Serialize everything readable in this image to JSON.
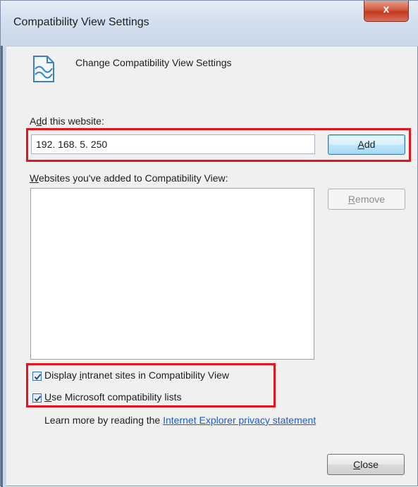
{
  "window": {
    "title": "Compatibility View Settings",
    "close_label": "x"
  },
  "header": {
    "icon": "compatibility-page-icon",
    "text": "Change Compatibility View Settings"
  },
  "add_section": {
    "label_prefix": "A",
    "label_accel": "d",
    "label_suffix": "d this website:",
    "value": "192. 168. 5. 250",
    "add_button_accel": "A",
    "add_button_rest": "dd"
  },
  "list_section": {
    "label_accel": "W",
    "label_suffix": "ebsites you've added to Compatibility View:",
    "items": [],
    "remove_button_accel": "R",
    "remove_button_rest": "emove"
  },
  "options": {
    "intranet": {
      "prefix": "Display ",
      "accel": "i",
      "suffix": "ntranet sites in Compatibility View",
      "checked": true
    },
    "ms_lists": {
      "prefix": "",
      "accel": "U",
      "suffix": "se Microsoft compatibility lists",
      "checked": true
    }
  },
  "footer": {
    "learn_more": "Learn more by reading the ",
    "link_text": "Internet Explorer privacy statement",
    "close_button_accel": "C",
    "close_button_rest": "lose"
  },
  "colors": {
    "highlight_box": "#e3141b",
    "link": "#1a5ec5",
    "title_close": "#c0381f"
  }
}
